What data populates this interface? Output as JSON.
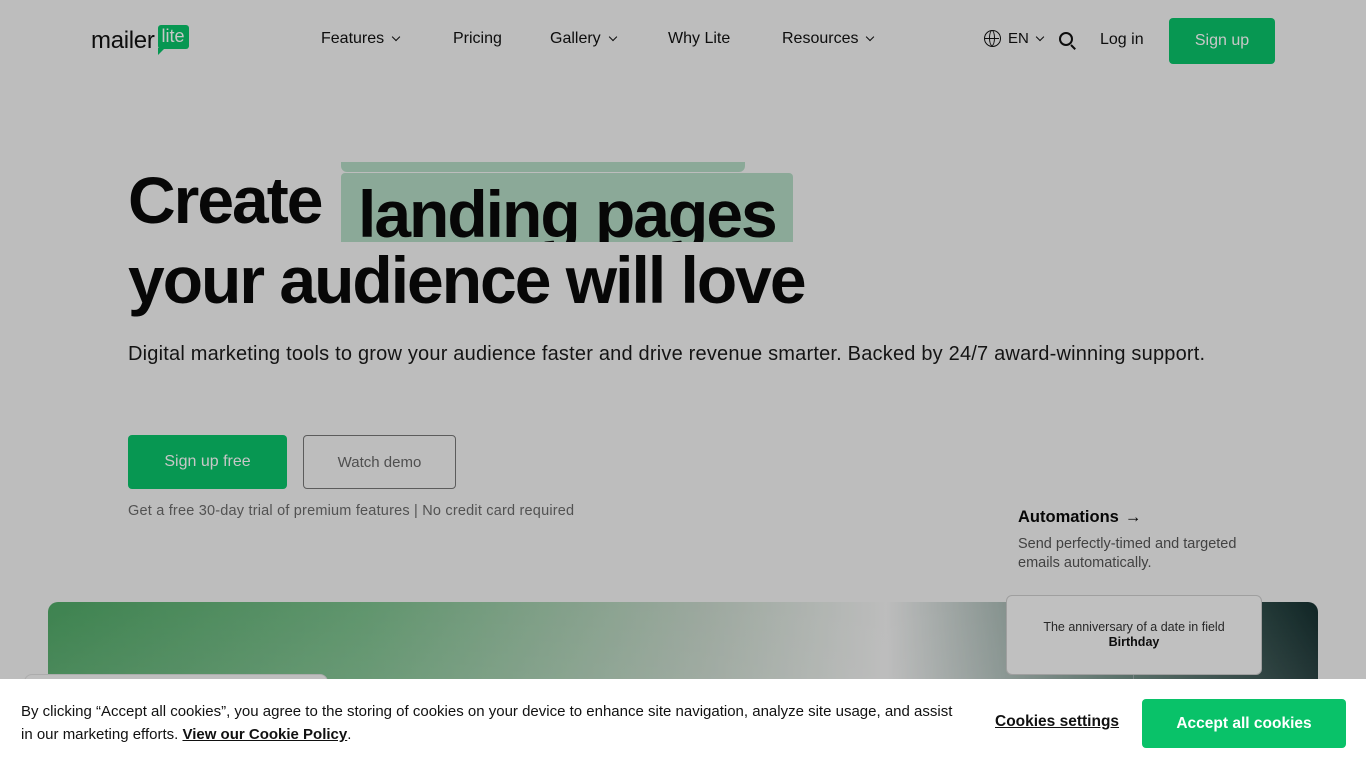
{
  "brand": {
    "logo_word": "mailer",
    "logo_badge": "lite",
    "accent_color": "#09c269",
    "highlight_color": "#b3d9c3"
  },
  "nav": {
    "items": [
      {
        "label": "Features",
        "has_dropdown": true
      },
      {
        "label": "Pricing",
        "has_dropdown": false
      },
      {
        "label": "Gallery",
        "has_dropdown": true
      },
      {
        "label": "Why Lite",
        "has_dropdown": false
      },
      {
        "label": "Resources",
        "has_dropdown": true
      }
    ],
    "language": "EN",
    "login": "Log in",
    "signup": "Sign up"
  },
  "hero": {
    "title_prefix": "Create",
    "title_highlight": "landing pages",
    "title_line2": "your audience will love",
    "subtitle": "Digital marketing tools to grow your audience faster and drive revenue smarter. Backed by 24/7 award-winning support.",
    "cta_primary": "Sign up free",
    "cta_secondary": "Watch demo",
    "trial_note": "Get a free 30-day trial of premium features | No credit card required"
  },
  "automations": {
    "title": "Automations",
    "arrow": "→",
    "description": "Send perfectly-timed and targeted emails automatically.",
    "card_text": "The anniversary of a date in field",
    "card_field": "Birthday"
  },
  "cookie_banner": {
    "text": "By clicking “Accept all cookies”, you agree to the storing of cookies on your device to enhance site navigation, analyze site usage, and assist in our marketing efforts.",
    "policy_link": "View our Cookie Policy",
    "policy_suffix": ".",
    "settings_label": "Cookies settings",
    "accept_label": "Accept all cookies"
  }
}
